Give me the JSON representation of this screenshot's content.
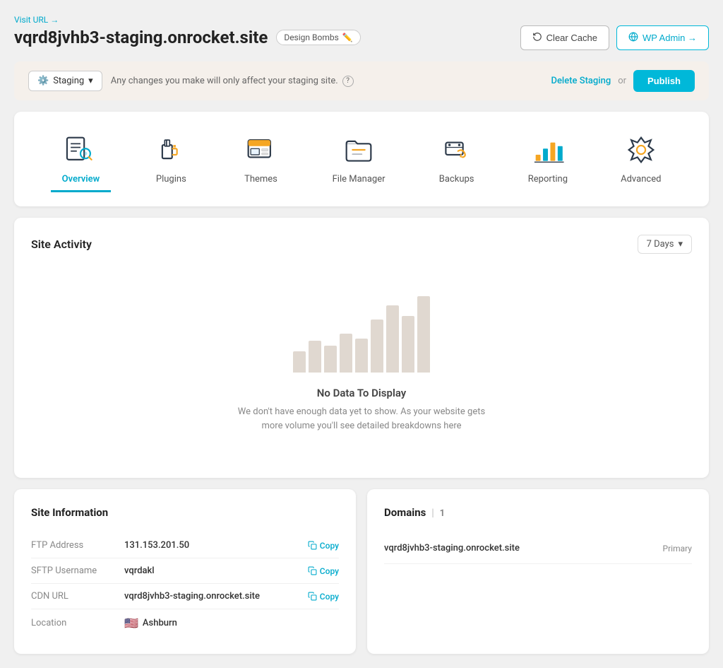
{
  "header": {
    "visit_url_label": "Visit URL →",
    "site_domain": "vqrd8jvhb3-staging.onrocket.site",
    "badge_label": "Design Bombs",
    "badge_icon": "✏️",
    "clear_cache_label": "Clear Cache",
    "wp_admin_label": "WP Admin →"
  },
  "staging_bar": {
    "dropdown_label": "Staging",
    "note": "Any changes you make will only affect your staging site.",
    "delete_label": "Delete Staging",
    "or_text": "or",
    "publish_label": "Publish"
  },
  "nav_tabs": [
    {
      "id": "overview",
      "label": "Overview",
      "active": true
    },
    {
      "id": "plugins",
      "label": "Plugins",
      "active": false
    },
    {
      "id": "themes",
      "label": "Themes",
      "active": false
    },
    {
      "id": "file-manager",
      "label": "File Manager",
      "active": false
    },
    {
      "id": "backups",
      "label": "Backups",
      "active": false
    },
    {
      "id": "reporting",
      "label": "Reporting",
      "active": false
    },
    {
      "id": "advanced",
      "label": "Advanced",
      "active": false
    }
  ],
  "activity": {
    "title": "Site Activity",
    "days_select": "7 Days",
    "empty_title": "No Data To Display",
    "empty_message": "We don't have enough data yet to show. As your website gets more volume you'll see detailed breakdowns here",
    "chart_bars": [
      20,
      30,
      25,
      40,
      35,
      55,
      70,
      60,
      80
    ]
  },
  "site_info": {
    "title": "Site Information",
    "rows": [
      {
        "label": "FTP Address",
        "value": "131.153.201.50",
        "copyable": true
      },
      {
        "label": "SFTP Username",
        "value": "vqrdakl",
        "copyable": true
      },
      {
        "label": "CDN URL",
        "value": "vqrd8jvhb3-staging.onrocket.site",
        "copyable": true
      },
      {
        "label": "Location",
        "value": "Ashburn",
        "copyable": false,
        "flag": true
      }
    ],
    "copy_label": "Copy"
  },
  "domains": {
    "title": "Domains",
    "count": "1",
    "rows": [
      {
        "name": "vqrd8jvhb3-staging.onrocket.site",
        "badge": "Primary"
      }
    ]
  },
  "colors": {
    "accent": "#00aacc",
    "orange": "#f5a623",
    "staging_bg": "#f5f0eb"
  }
}
